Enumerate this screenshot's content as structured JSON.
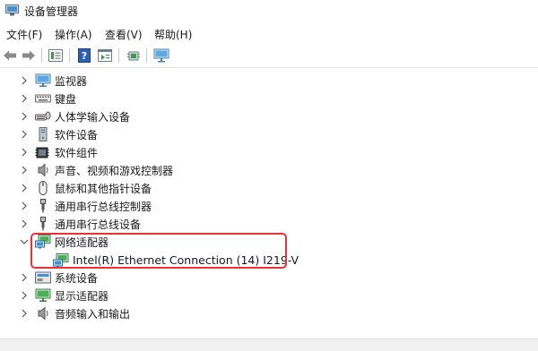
{
  "window": {
    "title": "设备管理器"
  },
  "menu": [
    "文件(F)",
    "操作(A)",
    "查看(V)",
    "帮助(H)"
  ],
  "toolbar": [
    "back-icon",
    "forward-icon",
    "properties-icon",
    "help-icon",
    "view-icon",
    "scan-hardware-icon",
    "monitor-icon"
  ],
  "tree": {
    "items": [
      {
        "label": "监视器",
        "icon": "monitor-icon",
        "expanded": false
      },
      {
        "label": "键盘",
        "icon": "keyboard-icon",
        "expanded": false
      },
      {
        "label": "人体学输入设备",
        "icon": "hid-icon",
        "expanded": false
      },
      {
        "label": "软件设备",
        "icon": "software-device-icon",
        "expanded": false
      },
      {
        "label": "软件组件",
        "icon": "software-component-icon",
        "expanded": false
      },
      {
        "label": "声音、视频和游戏控制器",
        "icon": "speaker-icon",
        "expanded": false
      },
      {
        "label": "鼠标和其他指针设备",
        "icon": "mouse-icon",
        "expanded": false
      },
      {
        "label": "通用串行总线控制器",
        "icon": "usb-icon",
        "expanded": false
      },
      {
        "label": "通用串行总线设备",
        "icon": "usb-icon",
        "expanded": false
      },
      {
        "label": "网络适配器",
        "icon": "network-adapter-icon",
        "expanded": true,
        "children": [
          {
            "label": "Intel(R) Ethernet Connection (14) I219-V",
            "icon": "network-adapter-icon"
          }
        ]
      },
      {
        "label": "系统设备",
        "icon": "system-device-icon",
        "expanded": false
      },
      {
        "label": "显示适配器",
        "icon": "display-adapter-icon",
        "expanded": false
      },
      {
        "label": "音频输入和输出",
        "icon": "speaker-icon",
        "expanded": false
      }
    ]
  },
  "colors": {
    "highlight": "#e8323a",
    "chevron": "#555555"
  }
}
